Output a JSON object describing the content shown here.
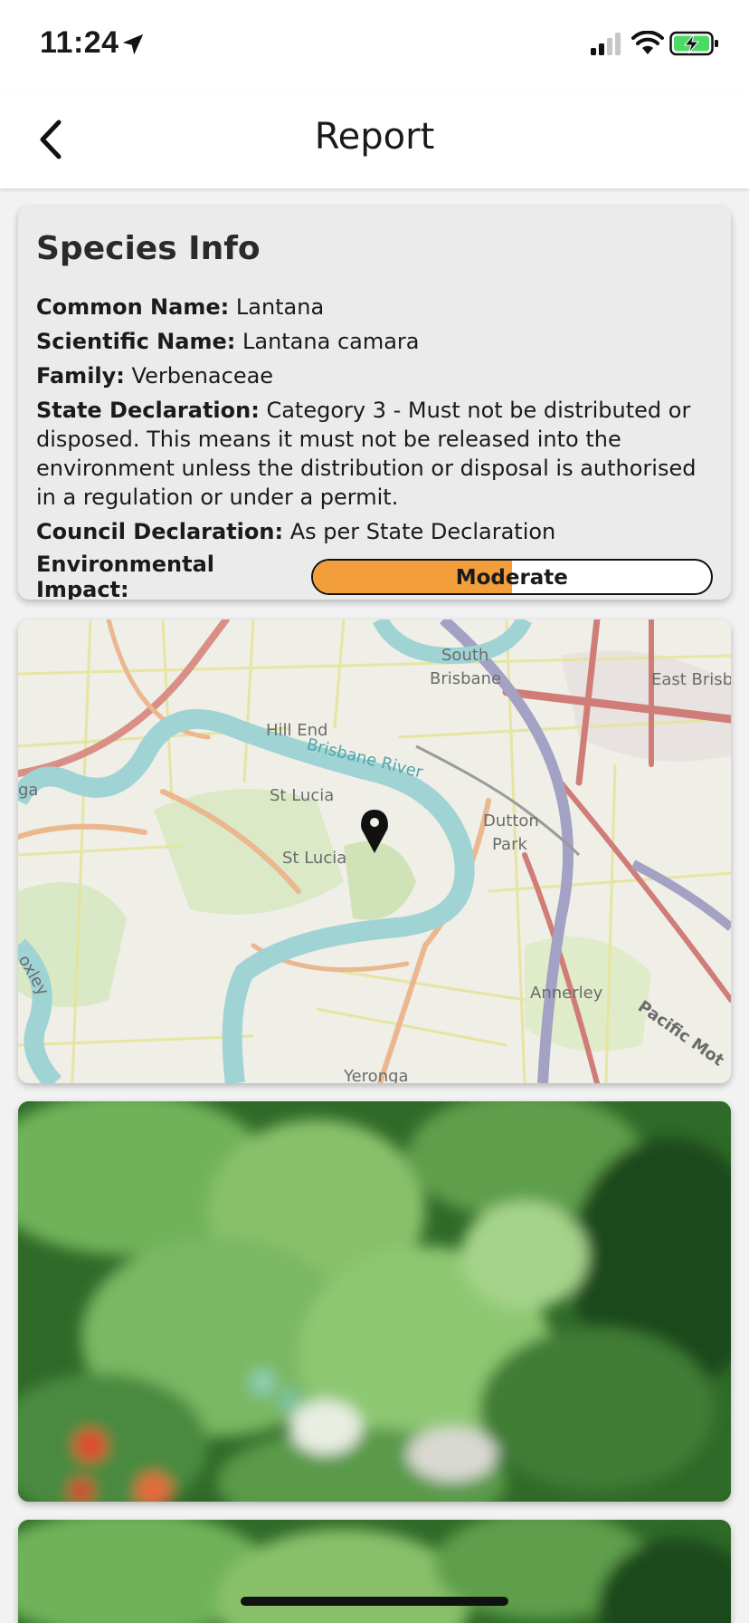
{
  "status_bar": {
    "time": "11:24",
    "icons": [
      "location-arrow-icon",
      "cellular-signal-icon",
      "wifi-icon",
      "battery-charging-icon"
    ]
  },
  "nav": {
    "title": "Report",
    "back_icon": "chevron-left-icon"
  },
  "species_info": {
    "title": "Species Info",
    "common_name_label": "Common Name:",
    "common_name": "Lantana",
    "scientific_name_label": "Scientific Name:",
    "scientific_name": "Lantana camara",
    "family_label": "Family:",
    "family": "Verbenaceae",
    "state_declaration_label": "State Declaration:",
    "state_declaration": "Category 3 - Must not be distributed or disposed. This means it must not be released into the environment unless the distribution or disposal is authorised in a regulation or under a permit.",
    "council_declaration_label": "Council Declaration:",
    "council_declaration": "As per State Declaration",
    "environmental_impact_label": "Environmental Impact:",
    "environmental_impact": "Moderate",
    "environmental_impact_level": 0.5,
    "impact_color": "#f19e3b"
  },
  "map": {
    "labels": {
      "south_brisbane": "South\nBrisbane",
      "east_brisbane": "East Brisb",
      "hill_end": "Hill End",
      "brisbane_river": "Brisbane River",
      "st_lucia_1": "St Lucia",
      "st_lucia_2": "St Lucia",
      "dutton_park": "Dutton\nPark",
      "annerley": "Annerley",
      "pacific_mot": "Pacific Mot",
      "ga": "ga",
      "oxley": "oxley",
      "yeronga": "Yeronga"
    },
    "pin_icon": "map-pin-icon"
  },
  "photos": [
    {
      "name": "plant-photo-1"
    },
    {
      "name": "plant-photo-2"
    }
  ],
  "colors": {
    "accent_orange": "#f19e3b",
    "river": "#9fd3d4"
  }
}
